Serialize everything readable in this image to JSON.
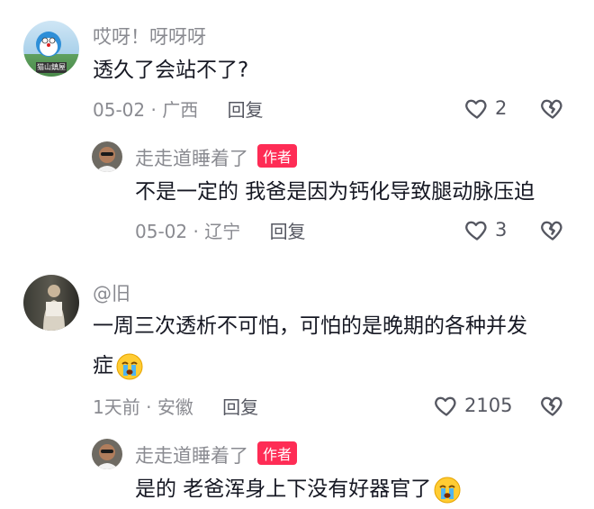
{
  "comments": [
    {
      "username": "哎呀！呀呀呀",
      "avatar_badge": "猫山鎮屋",
      "text": "透久了会站不了?",
      "date": "05-02",
      "location": "广西",
      "reply_label": "回复",
      "likes": "2",
      "reply": {
        "username": "走走道睡着了",
        "author_tag": "作者",
        "text": "不是一定的 我爸是因为钙化导致腿动脉压迫",
        "date": "05-02",
        "location": "辽宁",
        "reply_label": "回复",
        "likes": "3"
      }
    },
    {
      "username": "@旧",
      "text_line1": "一周三次透析不可怕，可怕的是晚期的各种并发",
      "text_line2": "症",
      "date": "1天前",
      "location": "安徽",
      "reply_label": "回复",
      "likes": "2105",
      "reply": {
        "username": "走走道睡着了",
        "author_tag": "作者",
        "text": "是的 老爸浑身上下没有好器官了"
      }
    }
  ],
  "icons": {
    "like": "heart-outline-icon",
    "dislike": "broken-heart-icon",
    "emoji": "crying-face-emoji"
  },
  "colors": {
    "author_tag_bg": "#fe2c55",
    "meta_text": "#8a8b91",
    "body_text": "#161823"
  }
}
